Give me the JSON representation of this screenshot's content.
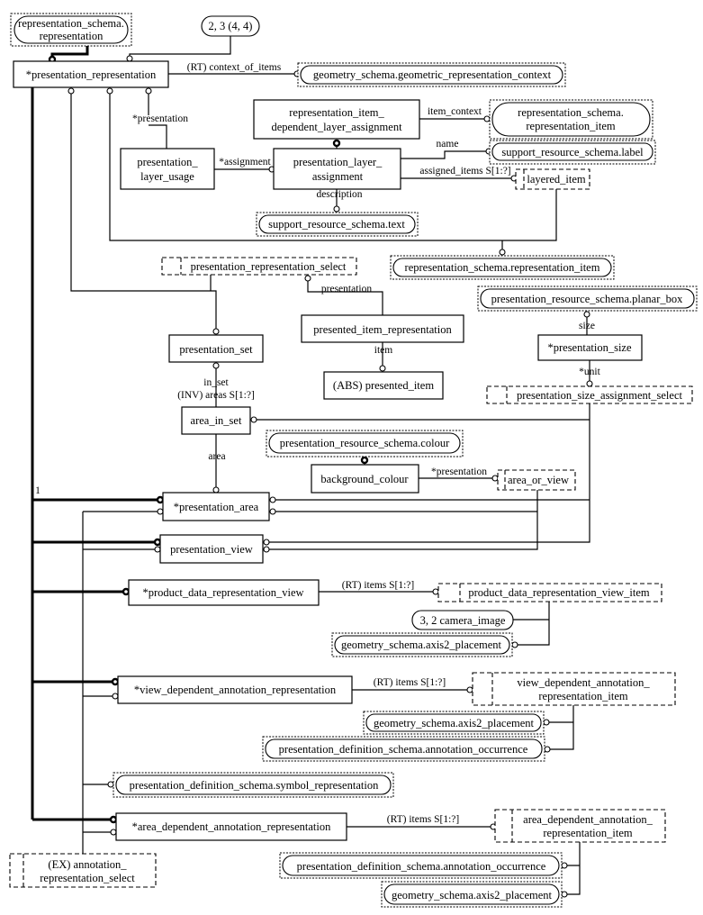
{
  "diagram": {
    "notation": "EXPRESS-G",
    "nodes": {
      "rs_representation": {
        "kind": "reference",
        "lines": [
          "representation_schema.",
          "representation"
        ]
      },
      "page_ref_top": {
        "kind": "page-reference",
        "label": "2, 3 (4, 4)"
      },
      "presentation_representation": {
        "kind": "entity",
        "label": "*presentation_representation"
      },
      "geometric_representation_context": {
        "kind": "reference",
        "label": "geometry_schema.geometric_representation_context"
      },
      "rep_item_dep_layer_assignment": {
        "kind": "entity",
        "lines": [
          "representation_item_",
          "dependent_layer_assignment"
        ]
      },
      "rs_representation_item_top": {
        "kind": "reference",
        "lines": [
          "representation_schema.",
          "representation_item"
        ]
      },
      "srs_label": {
        "kind": "reference",
        "label": "support_resource_schema.label"
      },
      "presentation_layer_usage": {
        "kind": "entity",
        "lines": [
          "presentation_",
          "layer_usage"
        ]
      },
      "presentation_layer_assignment": {
        "kind": "entity",
        "lines": [
          "presentation_layer_",
          "assignment"
        ]
      },
      "layered_item": {
        "kind": "select",
        "label": "layered_item"
      },
      "srs_text": {
        "kind": "reference",
        "label": "support_resource_schema.text"
      },
      "rs_representation_item_mid": {
        "kind": "reference",
        "label": "representation_schema.representation_item"
      },
      "presentation_representation_select": {
        "kind": "select",
        "label": "presentation_representation_select"
      },
      "planar_box": {
        "kind": "reference",
        "label": "presentation_resource_schema.planar_box"
      },
      "presented_item_representation": {
        "kind": "entity",
        "label": "presented_item_representation"
      },
      "presentation_set": {
        "kind": "entity",
        "label": "presentation_set"
      },
      "presentation_size": {
        "kind": "entity",
        "label": "*presentation_size"
      },
      "presented_item": {
        "kind": "entity",
        "label": "(ABS) presented_item"
      },
      "presentation_size_assignment_select": {
        "kind": "select",
        "label": "presentation_size_assignment_select"
      },
      "area_in_set": {
        "kind": "entity",
        "label": "area_in_set"
      },
      "colour": {
        "kind": "reference",
        "label": "presentation_resource_schema.colour"
      },
      "background_colour": {
        "kind": "entity",
        "label": "background_colour"
      },
      "area_or_view": {
        "kind": "select",
        "label": "area_or_view"
      },
      "presentation_area": {
        "kind": "entity",
        "label": "*presentation_area"
      },
      "presentation_view": {
        "kind": "entity",
        "label": "presentation_view"
      },
      "product_data_representation_view": {
        "kind": "entity",
        "label": "*product_data_representation_view"
      },
      "product_data_representation_view_item": {
        "kind": "select",
        "label": "product_data_representation_view_item"
      },
      "camera_image": {
        "kind": "page-reference",
        "label": "3, 2 camera_image"
      },
      "axis2_placement_1": {
        "kind": "reference",
        "label": "geometry_schema.axis2_placement"
      },
      "view_dependent_annotation_representation": {
        "kind": "entity",
        "label": "*view_dependent_annotation_representation"
      },
      "view_dependent_annotation_representation_item": {
        "kind": "select",
        "lines": [
          "view_dependent_annotation_",
          "representation_item"
        ]
      },
      "axis2_placement_2": {
        "kind": "reference",
        "label": "geometry_schema.axis2_placement"
      },
      "annotation_occurrence_1": {
        "kind": "reference",
        "label": "presentation_definition_schema.annotation_occurrence"
      },
      "symbol_representation": {
        "kind": "reference",
        "label": "presentation_definition_schema.symbol_representation"
      },
      "area_dependent_annotation_representation": {
        "kind": "entity",
        "label": "*area_dependent_annotation_representation"
      },
      "area_dependent_annotation_representation_item": {
        "kind": "select",
        "lines": [
          "area_dependent_annotation_",
          "representation_item"
        ]
      },
      "annotation_occurrence_2": {
        "kind": "reference",
        "label": "presentation_definition_schema.annotation_occurrence"
      },
      "axis2_placement_3": {
        "kind": "reference",
        "label": "geometry_schema.axis2_placement"
      },
      "annotation_representation_select": {
        "kind": "select",
        "lines": [
          "(EX) annotation_",
          "representation_select"
        ]
      }
    },
    "relation_labels": {
      "context_of_items": "(RT) context_of_items",
      "presentation_1": "*presentation",
      "item_context": "item_context",
      "name": "name",
      "assigned_items": "assigned_items S[1:?]",
      "assignment": "*assignment",
      "description": "description",
      "presentation_2": "presentation",
      "item": "item",
      "size": "size",
      "unit": "*unit",
      "in_set": "in_set",
      "areas": "(INV) areas S[1:?]",
      "area": "area",
      "presentation_3": "*presentation",
      "subtype_cardinality": "1",
      "items_1": "(RT) items S[1:?]",
      "items_2": "(RT) items S[1:?]",
      "items_3": "(RT) items S[1:?]"
    }
  }
}
